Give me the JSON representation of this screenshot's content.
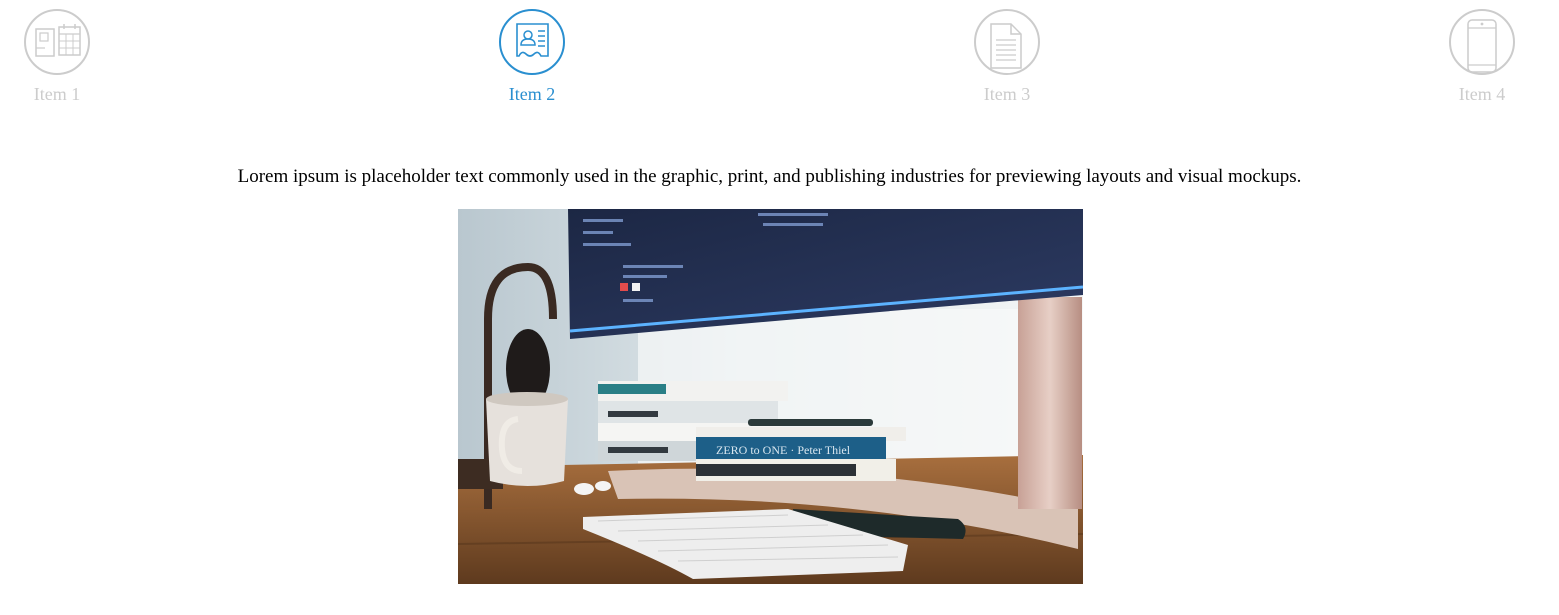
{
  "tabs": {
    "items": [
      {
        "label": "Item 1",
        "icon": "cards-calendar-icon",
        "active": false
      },
      {
        "label": "Item 2",
        "icon": "id-card-icon",
        "active": true
      },
      {
        "label": "Item 3",
        "icon": "document-icon",
        "active": false
      },
      {
        "label": "Item 4",
        "icon": "mobile-phone-icon",
        "active": false
      }
    ],
    "active_color": "#2a8fd0",
    "inactive_color": "#cccccc"
  },
  "content": {
    "caption": "Lorem ipsum is placeholder text commonly used in the graphic, print, and publishing industries for previewing layouts and visual mockups."
  }
}
